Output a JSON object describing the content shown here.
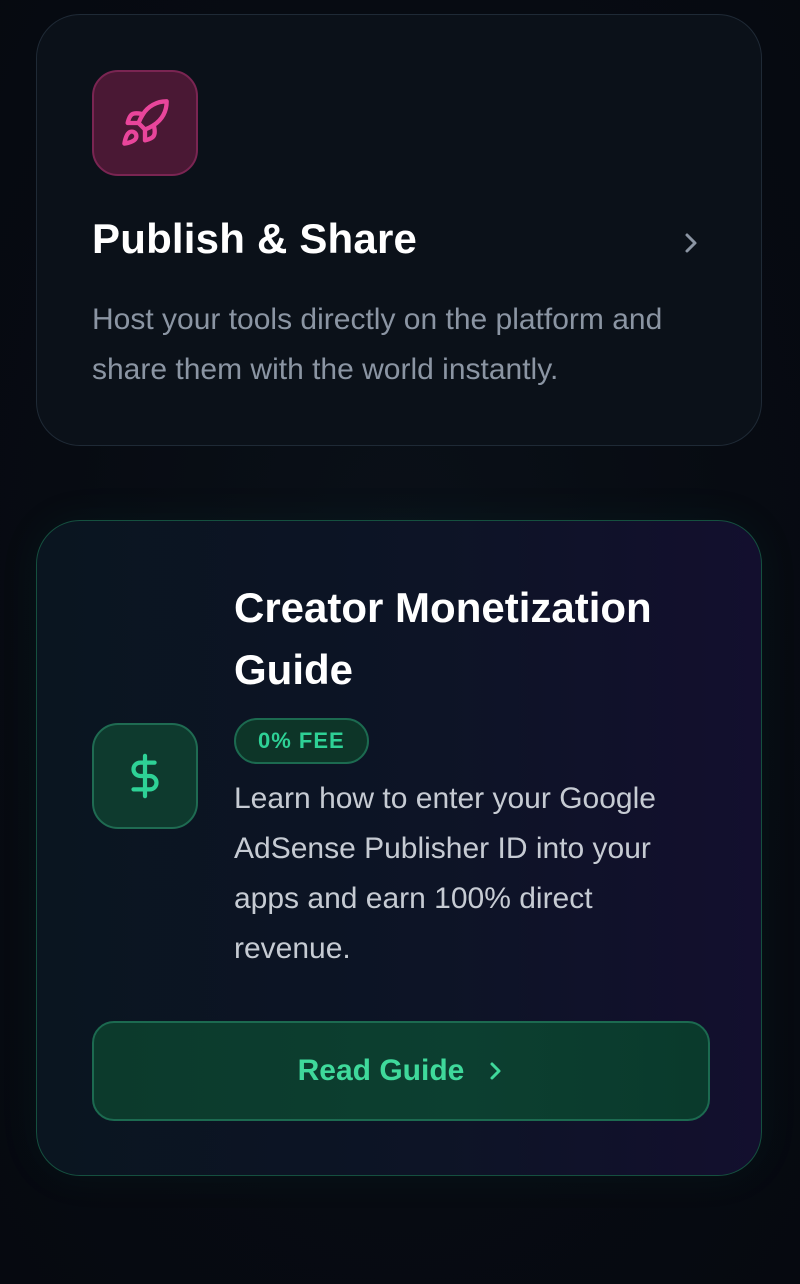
{
  "publish_card": {
    "title": "Publish & Share",
    "description": "Host your tools directly on the platform and share them with the world instantly.",
    "icon": "rocket-icon",
    "accent": "#e9459b"
  },
  "monetization_card": {
    "title": "Creator Monetization Guide",
    "badge": "0% FEE",
    "description": "Learn how to enter your Google AdSense Publisher ID into your apps and earn 100% direct revenue.",
    "icon": "dollar-icon",
    "button_label": "Read Guide",
    "accent": "#2ed196"
  }
}
